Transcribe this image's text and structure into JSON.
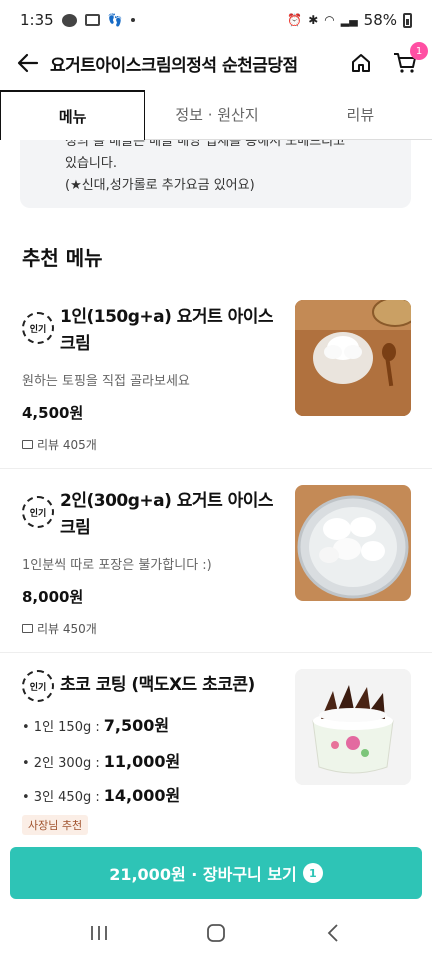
{
  "status_bar": {
    "time": "1:35",
    "battery": "58%"
  },
  "header": {
    "title": "요거트아이스크림의정석 순천금당점",
    "cart_badge": "1"
  },
  "tabs": [
    {
      "label": "메뉴"
    },
    {
      "label": "정보 · 원산지"
    },
    {
      "label": "리뷰"
    }
  ],
  "notice": {
    "line0": "정의 볼 배골은 배골 배앙 입세를 용해서 노베드리고",
    "line1": "있습니다.",
    "line2": "(★신대,성가롤로 추가요금 있어요)"
  },
  "section_title": "추천 메뉴",
  "popular_label": "인기",
  "items": [
    {
      "name": "1인(150g+a) 요거트 아이스크림",
      "desc": "원하는 토핑을 직접 골라보세요",
      "price": "4,500원",
      "reviews": "리뷰 405개"
    },
    {
      "name": "2인(300g+a) 요거트 아이스크림",
      "desc": "1인분씩 따로 포장은 불가합니다 :)",
      "price": "8,000원",
      "reviews": "리뷰 450개"
    },
    {
      "name": "초코 코팅 (맥도X드 초코콘)",
      "options": [
        {
          "label": "• 1인 150g : ",
          "price": "7,500원"
        },
        {
          "label": "• 2인 300g : ",
          "price": "11,000원"
        },
        {
          "label": "• 3인 450g : ",
          "price": "14,000원"
        }
      ],
      "tag": "사장님 추천"
    }
  ],
  "cart_bar": {
    "label": "21,000원 · 장바구니 보기",
    "count": "1"
  },
  "colors": {
    "accent": "#2ec4b6",
    "badge": "#ff4fa3"
  }
}
